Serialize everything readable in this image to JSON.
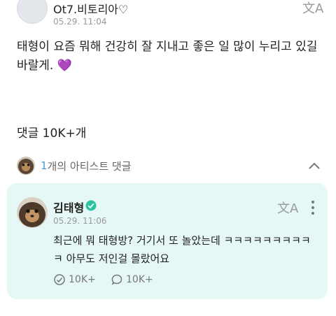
{
  "post": {
    "author": "Ot7.비토리아♡",
    "date": "05.29. 11:04",
    "body": "태형이 요즘 뭐해 건강히 잘 지내고 좋은 일 많이 누리고 있길 바랄게.",
    "emoji": "💜",
    "translate_icon": "文A"
  },
  "comments": {
    "title": "댓글 10K+개"
  },
  "artist_section": {
    "count": "1",
    "label": "개의 아티스트 댓글",
    "collapse_icon": "chevron-up-icon"
  },
  "artist_comment": {
    "author": "김태형",
    "verified": true,
    "date": "05.29. 11:06",
    "body": "최근에 뭐 태형방? 거기서 또 놀았는데 ㅋㅋㅋㅋㅋㅋㅋㅋㅋㅋ 아무도 저인걸 몰랐어요",
    "translate_icon": "文A",
    "likes": "10K+",
    "replies": "10K+"
  },
  "colors": {
    "card_bg": "#e6f8f5",
    "accent_blue": "#4a9bd8",
    "verified_green": "#2cc4a0",
    "heart_purple": "#9b4fe0"
  }
}
